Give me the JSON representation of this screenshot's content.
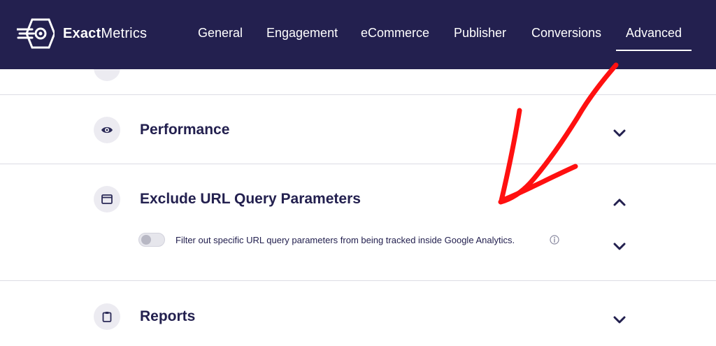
{
  "app": {
    "logo_bold": "Exact",
    "logo_regular": "Metrics"
  },
  "nav": {
    "items": [
      {
        "label": "General"
      },
      {
        "label": "Engagement"
      },
      {
        "label": "eCommerce"
      },
      {
        "label": "Publisher"
      },
      {
        "label": "Conversions"
      },
      {
        "label": "Advanced",
        "active": true
      }
    ]
  },
  "sections": {
    "performance": {
      "title": "Performance",
      "icon": "eye-icon",
      "expanded": false
    },
    "exclude": {
      "title": "Exclude URL Query Parameters",
      "icon": "browser-window-icon",
      "expanded": true,
      "toggle_on": false,
      "toggle_label": "Filter out specific URL query parameters from being tracked inside Google Analytics."
    },
    "reports": {
      "title": "Reports",
      "icon": "clipboard-icon",
      "expanded": false
    }
  },
  "colors": {
    "header_bg": "#23204f",
    "title_text": "#23204f",
    "annotation_arrow": "#ff1010"
  }
}
